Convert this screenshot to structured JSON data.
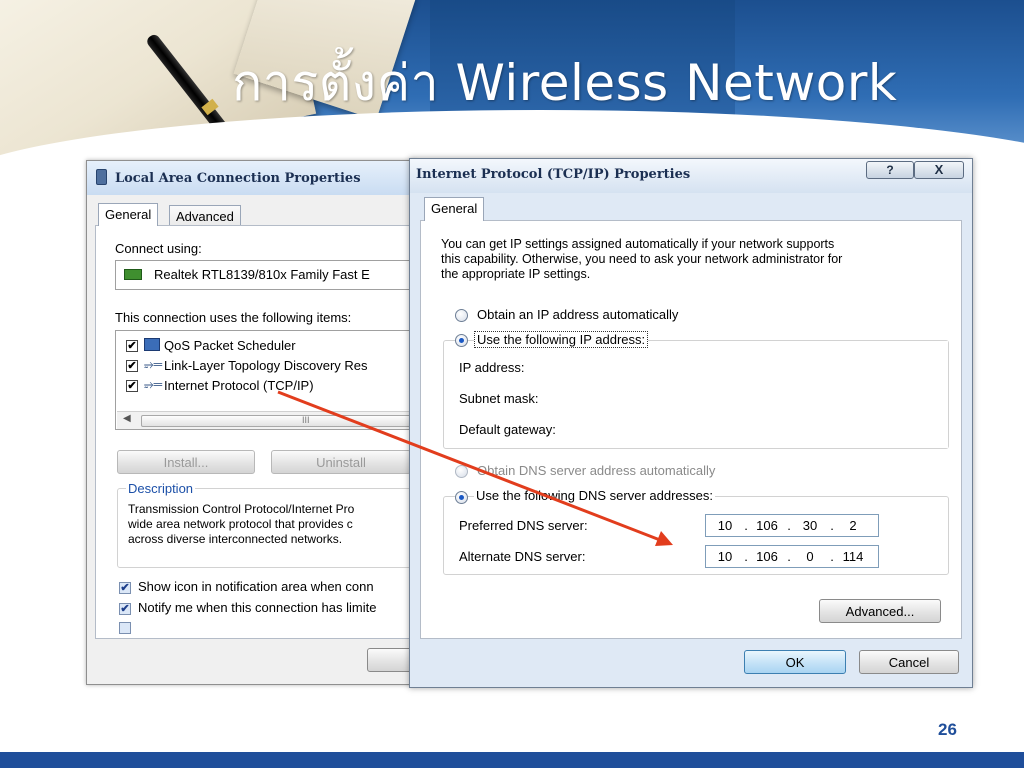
{
  "slide": {
    "title": "การตั้งค่า Wireless Network",
    "page_number": "26",
    "colors": {
      "header_blue": "#2f6db4",
      "footer_blue": "#1f4e9a",
      "arrow_red": "#e23d1d"
    }
  },
  "lac_dialog": {
    "title": "Local Area Connection Properties",
    "tabs": [
      "General",
      "Advanced"
    ],
    "connect_using_label": "Connect using:",
    "adapter": "Realtek RTL8139/810x Family Fast E",
    "items_label": "This connection uses the following items:",
    "items": [
      {
        "label": "QoS Packet Scheduler",
        "checked": true
      },
      {
        "label": "Link-Layer Topology Discovery Res",
        "checked": true
      },
      {
        "label": "Internet Protocol (TCP/IP)",
        "checked": true
      }
    ],
    "scrollbar_glyph": "III",
    "buttons": {
      "install": "Install...",
      "uninstall": "Uninstall"
    },
    "description_label": "Description",
    "description_lines": [
      "Transmission Control Protocol/Internet Pro",
      "wide area network protocol that provides c",
      "across diverse interconnected networks."
    ],
    "show_icon_label": "Show icon in notification area when conn",
    "notify_label": "Notify me when this connection has limite"
  },
  "tcp_dialog": {
    "title": "Internet Protocol (TCP/IP) Properties",
    "help_button": "?",
    "close_button": "X",
    "tab": "General",
    "intro_lines": [
      "You can get IP settings assigned automatically if your network supports",
      "this capability. Otherwise, you need to ask your network administrator for",
      "the appropriate IP settings."
    ],
    "ip_auto_label": "Obtain an IP address automatically",
    "ip_manual_label": "Use the following IP address:",
    "ip_mode": "manual",
    "ip_address_label": "IP address:",
    "subnet_label": "Subnet mask:",
    "gateway_label": "Default gateway:",
    "dns_auto_label": "Obtain DNS server address automatically",
    "dns_manual_label": "Use the following DNS server addresses:",
    "dns_mode": "manual",
    "preferred_dns_label": "Preferred DNS server:",
    "preferred_dns": [
      "10",
      "106",
      "30",
      "2"
    ],
    "alternate_dns_label": "Alternate DNS server:",
    "alternate_dns": [
      "10",
      "106",
      "0",
      "114"
    ],
    "advanced_button": "Advanced...",
    "ok_button": "OK",
    "cancel_button": "Cancel"
  }
}
